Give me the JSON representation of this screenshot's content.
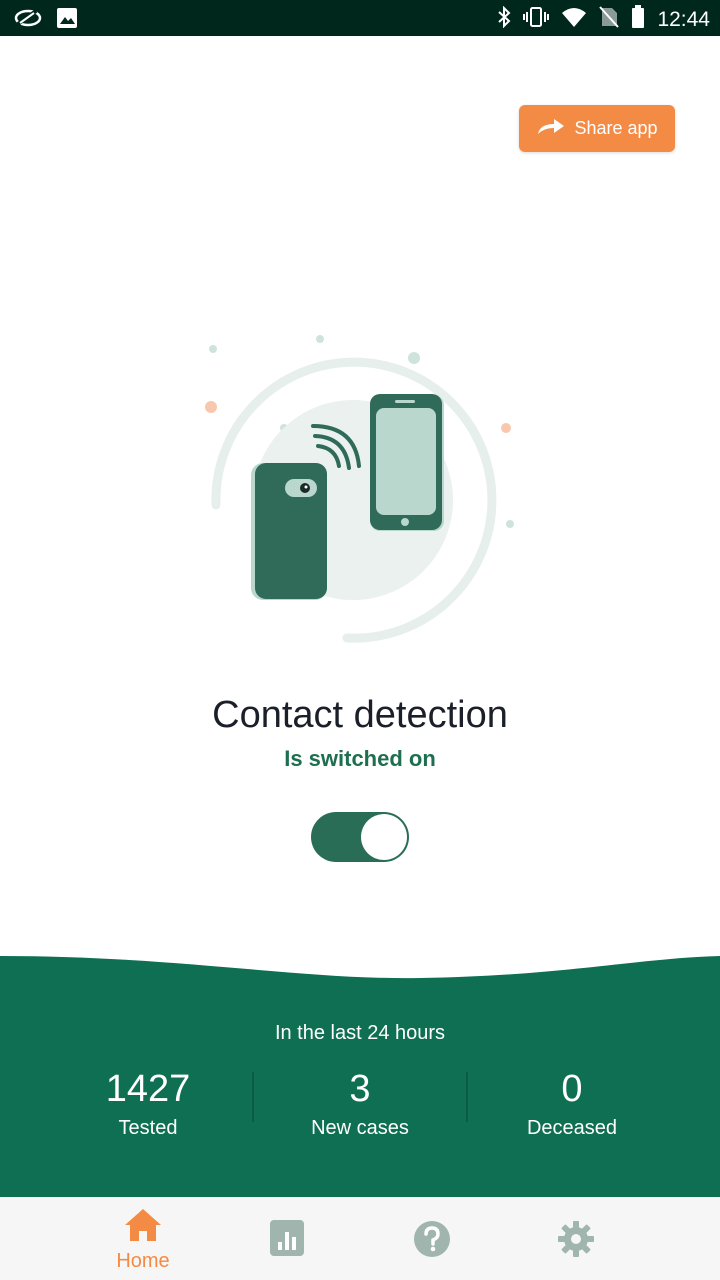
{
  "status_bar": {
    "time": "12:44",
    "icons": [
      "app-logo-icon",
      "image-icon",
      "bluetooth-icon",
      "vibrate-icon",
      "wifi-icon",
      "no-sim-icon",
      "battery-icon"
    ]
  },
  "share": {
    "label": "Share app",
    "icon": "share-arrow-icon"
  },
  "detection": {
    "title": "Contact detection",
    "status": "Is switched on",
    "toggle_on": true
  },
  "stats": {
    "header": "In the last 24 hours",
    "items": [
      {
        "value": "1427",
        "label": "Tested"
      },
      {
        "value": "3",
        "label": "New cases"
      },
      {
        "value": "0",
        "label": "Deceased"
      }
    ]
  },
  "nav": {
    "items": [
      {
        "label": "Home",
        "icon": "home-icon",
        "active": true
      },
      {
        "label": "",
        "icon": "stats-chart-icon",
        "active": false
      },
      {
        "label": "",
        "icon": "help-icon",
        "active": false
      },
      {
        "label": "",
        "icon": "settings-gear-icon",
        "active": false
      }
    ]
  },
  "colors": {
    "primary_green": "#0f6f52",
    "accent_orange": "#f48b45",
    "status_bar": "#00271b"
  }
}
